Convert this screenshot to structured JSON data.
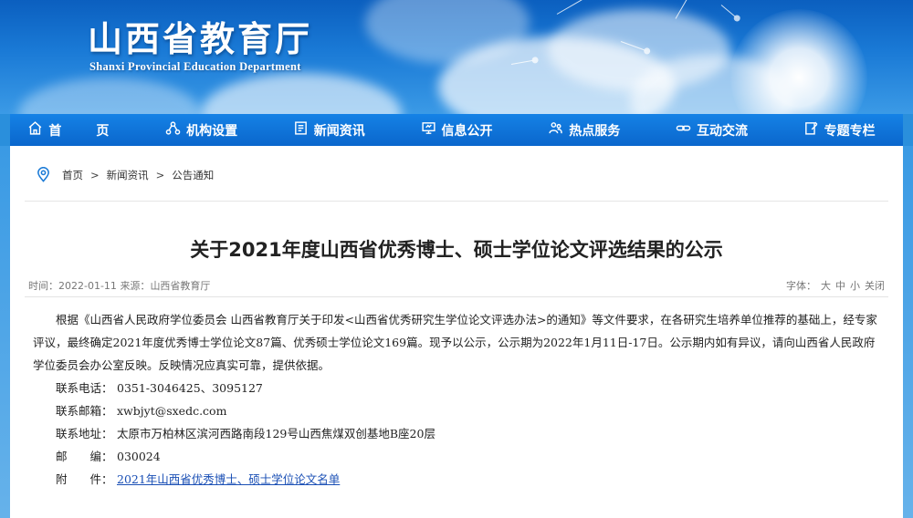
{
  "site": {
    "name_cn": "山西省教育厅",
    "name_en": "Shanxi Provincial Education Department"
  },
  "nav": {
    "items": [
      {
        "label": "首　页",
        "icon": "home-icon"
      },
      {
        "label": "机构设置",
        "icon": "org-icon"
      },
      {
        "label": "新闻资讯",
        "icon": "news-icon"
      },
      {
        "label": "信息公开",
        "icon": "monitor-icon"
      },
      {
        "label": "热点服务",
        "icon": "service-icon"
      },
      {
        "label": "互动交流",
        "icon": "link-icon"
      },
      {
        "label": "专题专栏",
        "icon": "edit-icon"
      }
    ]
  },
  "breadcrumb": {
    "items": [
      "首页",
      "新闻资讯",
      "公告通知"
    ],
    "separator": ">"
  },
  "article": {
    "title": "关于2021年度山西省优秀博士、硕士学位论文评选结果的公示",
    "time_label": "时间：",
    "time": "2022-01-11",
    "source_label": "来源：",
    "source": "山西省教育厅",
    "font_size_label": "字体：",
    "font_options": [
      "大",
      "中",
      "小"
    ],
    "close_label": "关闭",
    "paragraph": "根据《山西省人民政府学位委员会 山西省教育厅关于印发<山西省优秀研究生学位论文评选办法>的通知》等文件要求，在各研究生培养单位推荐的基础上，经专家评议，最终确定2021年度优秀博士学位论文87篇、优秀硕士学位论文169篇。现予以公示，公示期为2022年1月11日-17日。公示期内如有异议，请向山西省人民政府学位委员会办公室反映。反映情况应真实可靠，提供依据。",
    "contacts": {
      "phone_label": "联系电话：",
      "phone": "0351-3046425、3095127",
      "email_label": "联系邮箱：",
      "email": "xwbjyt@sxedc.com",
      "address_label": "联系地址：",
      "address": "太原市万柏林区滨河西路南段129号山西焦煤双创基地B座20层",
      "postcode_label": "邮　　编：",
      "postcode": "030024",
      "attachment_label": "附　　件：",
      "attachment": "2021年山西省优秀博士、硕士学位论文名单"
    }
  },
  "colors": {
    "nav_bg": "#0a66cc",
    "banner_bg": "#1a7ad6",
    "link": "#1a4fb5"
  }
}
